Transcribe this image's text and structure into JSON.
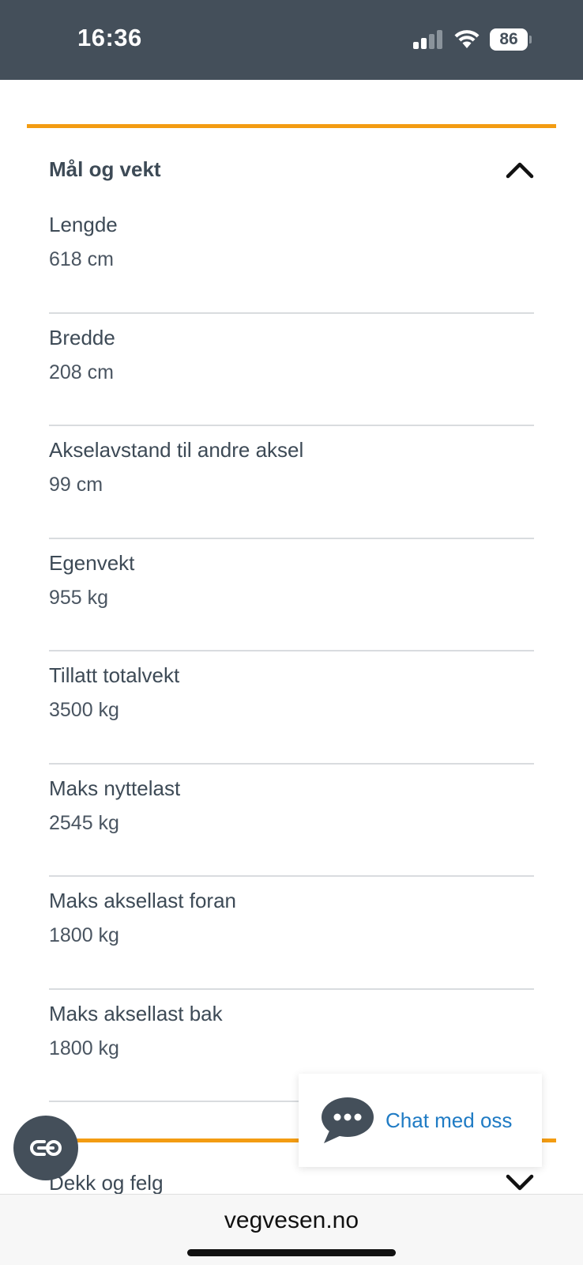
{
  "status_bar": {
    "time": "16:36",
    "battery": "86",
    "icons": [
      "cellular-signal-icon",
      "wifi-icon",
      "battery-icon"
    ]
  },
  "section_open": {
    "title": "Mål og vekt",
    "expanded": true,
    "rows": [
      {
        "label": "Lengde",
        "value": "618 cm"
      },
      {
        "label": "Bredde",
        "value": "208 cm"
      },
      {
        "label": "Akselavstand til andre aksel",
        "value": "99 cm"
      },
      {
        "label": "Egenvekt",
        "value": "955 kg"
      },
      {
        "label": "Tillatt totalvekt",
        "value": "3500 kg"
      },
      {
        "label": "Maks nyttelast",
        "value": "2545 kg"
      },
      {
        "label": "Maks aksellast foran",
        "value": "1800 kg"
      },
      {
        "label": "Maks aksellast bak",
        "value": "1800 kg"
      }
    ]
  },
  "section_next": {
    "title": "Dekk og felg",
    "expanded": false
  },
  "chat": {
    "label": "Chat med oss",
    "icon": "chat-bubble-icon"
  },
  "fab": {
    "icon": "link-icon"
  },
  "browser": {
    "url": "vegvesen.no"
  },
  "colors": {
    "accent": "#f39c12",
    "status_bar": "#444f5a",
    "text": "#3d4a56",
    "link": "#1f7bc4",
    "divider": "#d9dcdf"
  }
}
